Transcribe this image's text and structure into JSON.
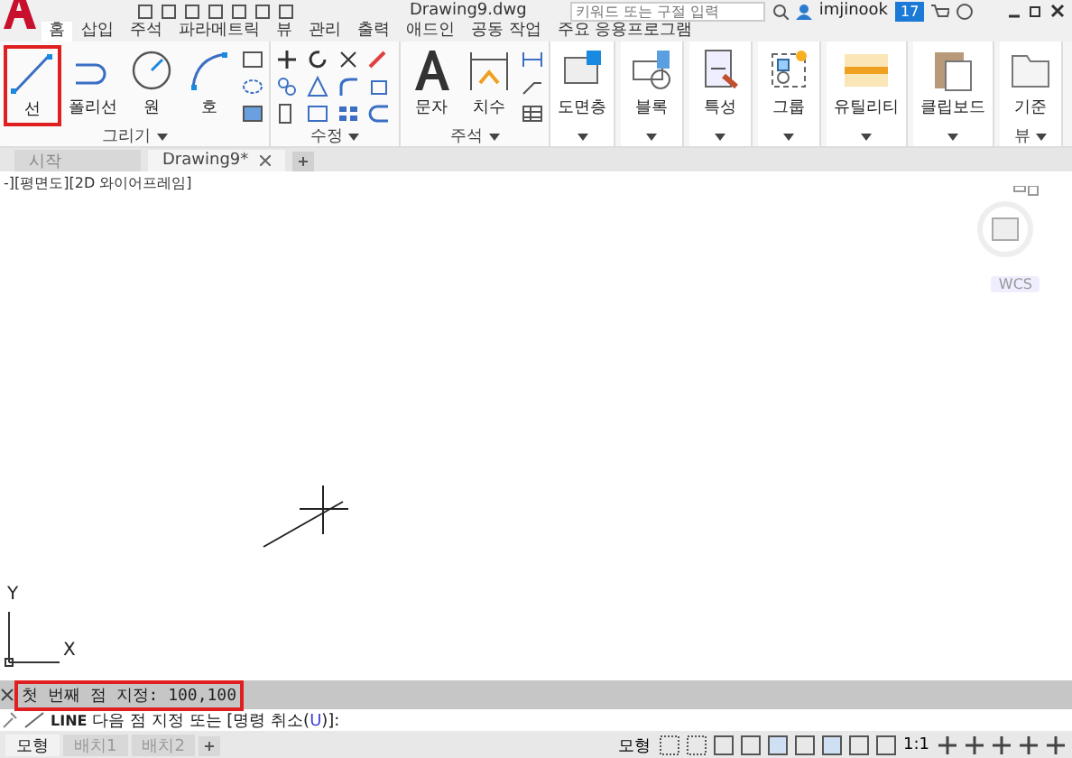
{
  "title_bar": {
    "file_name": "Drawing9.dwg",
    "search": {
      "placeholder": "키워드 또는 구절 입력"
    },
    "user": "imjinook",
    "notification_count": "17"
  },
  "ribbon_tabs": [
    {
      "label": "홈",
      "selected": true
    },
    {
      "label": "삽입",
      "selected": false
    },
    {
      "label": "주석",
      "selected": false
    },
    {
      "label": "파라메트릭",
      "selected": false
    },
    {
      "label": "뷰",
      "selected": false
    },
    {
      "label": "관리",
      "selected": false
    },
    {
      "label": "출력",
      "selected": false
    },
    {
      "label": "애드인",
      "selected": false
    },
    {
      "label": "공동 작업",
      "selected": false
    },
    {
      "label": "주요 응용프로그램",
      "selected": false
    }
  ],
  "ribbon_panels": [
    {
      "title": "그리기",
      "kind": "draw",
      "tools": [
        {
          "label": "선",
          "highlighted": true
        },
        {
          "label": "폴리선",
          "highlighted": false
        },
        {
          "label": "원",
          "highlighted": false
        },
        {
          "label": "호",
          "highlighted": false
        }
      ]
    },
    {
      "title": "수정",
      "kind": "modify"
    },
    {
      "title": "주석",
      "kind": "annotate",
      "tools": [
        {
          "label": "문자",
          "highlighted": false
        },
        {
          "label": "치수",
          "highlighted": false
        }
      ]
    },
    {
      "kind": "single",
      "tools": [
        {
          "label": "도면층",
          "highlighted": false
        }
      ]
    },
    {
      "kind": "single",
      "tools": [
        {
          "label": "블록",
          "highlighted": false
        }
      ]
    },
    {
      "kind": "single",
      "tools": [
        {
          "label": "특성",
          "highlighted": false
        }
      ]
    },
    {
      "kind": "single",
      "tools": [
        {
          "label": "그룹",
          "highlighted": false
        }
      ]
    },
    {
      "kind": "single",
      "tools": [
        {
          "label": "유틸리티",
          "highlighted": false
        }
      ]
    },
    {
      "kind": "single",
      "tools": [
        {
          "label": "클립보드",
          "highlighted": false
        }
      ]
    },
    {
      "title": "뷰",
      "kind": "view",
      "tools": [
        {
          "label": "기준",
          "highlighted": false
        }
      ]
    }
  ],
  "document_tabs": [
    {
      "label": "시작",
      "selected": false
    },
    {
      "label": "Drawing9*",
      "selected": true
    }
  ],
  "viewport": {
    "label": "-][평면도][2D 와이어프레임]",
    "coordinate_system": "WCS",
    "ucs": {
      "x_label": "X",
      "y_label": "Y"
    }
  },
  "command_history": {
    "text": "첫 번째 점 지정: 100,100",
    "highlighted": true
  },
  "command_line": {
    "command": "LINE",
    "prompt_before": "다음 점 지정 또는 [명령 취소(",
    "option_key": "U",
    "prompt_after": ")]:"
  },
  "layout_tabs": [
    {
      "label": "모형",
      "selected": true
    },
    {
      "label": "배치1",
      "selected": false
    },
    {
      "label": "배치2",
      "selected": false
    }
  ],
  "status_bar": {
    "space": "모형",
    "scale": "1:1"
  }
}
